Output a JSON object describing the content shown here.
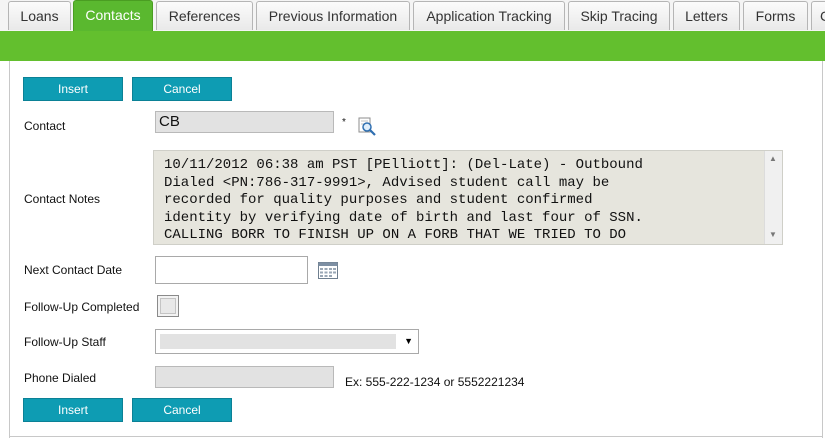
{
  "tabs": [
    {
      "label": "Loans"
    },
    {
      "label": "Contacts"
    },
    {
      "label": "References"
    },
    {
      "label": "Previous Information"
    },
    {
      "label": "Application Tracking"
    },
    {
      "label": "Skip Tracing"
    },
    {
      "label": "Letters"
    },
    {
      "label": "Forms"
    },
    {
      "label": "C"
    }
  ],
  "active_tab": "Contacts",
  "buttons": {
    "insert_label": "Insert",
    "cancel_label": "Cancel"
  },
  "form": {
    "contact": {
      "label": "Contact",
      "value": "CB",
      "required_marker": "*"
    },
    "contact_notes": {
      "label": "Contact Notes",
      "value": "10/11/2012 06:38 am PST [PElliott]: (Del-Late) - Outbound\nDialed <PN:786-317-9991>, Advised student call may be\nrecorded for quality purposes and student confirmed\nidentity by verifying date of birth and last four of SSN.\nCALLING BORR TO FINISH UP ON A FORB THAT WE TRIED TO DO"
    },
    "next_contact_date": {
      "label": "Next Contact Date",
      "value": ""
    },
    "follow_up_completed": {
      "label": "Follow-Up Completed",
      "checked": false
    },
    "follow_up_staff": {
      "label": "Follow-Up Staff",
      "value": ""
    },
    "phone_dialed": {
      "label": "Phone Dialed",
      "value": "",
      "hint": "Ex: 555-222-1234 or 5552221234"
    }
  },
  "colors": {
    "accent_green": "#63bf2e",
    "button_teal": "#0e9cb3"
  },
  "icons": [
    "lookup-magnifier-icon",
    "calendar-icon",
    "dropdown-arrow-icon",
    "scroll-up-icon",
    "scroll-down-icon"
  ]
}
